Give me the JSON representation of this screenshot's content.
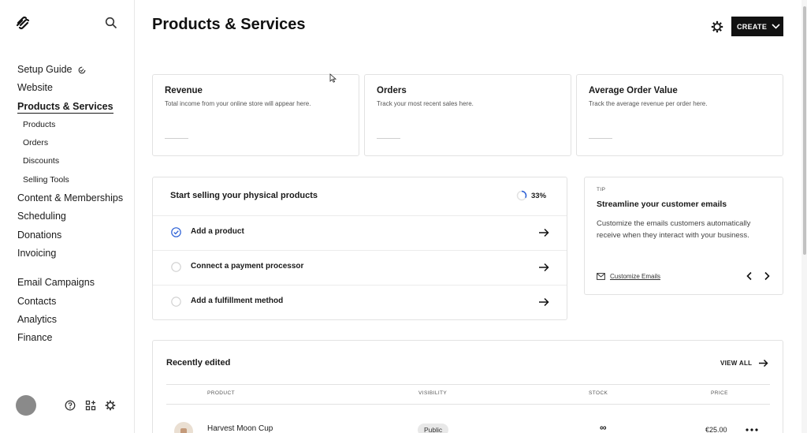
{
  "sidebar": {
    "nav": {
      "setup_guide": "Setup Guide",
      "website": "Website",
      "products_services": "Products & Services",
      "products": "Products",
      "orders": "Orders",
      "discounts": "Discounts",
      "selling_tools": "Selling Tools",
      "content_memberships": "Content & Memberships",
      "scheduling": "Scheduling",
      "donations": "Donations",
      "invoicing": "Invoicing",
      "email_campaigns": "Email Campaigns",
      "contacts": "Contacts",
      "analytics": "Analytics",
      "finance": "Finance"
    }
  },
  "header": {
    "title": "Products & Services",
    "create_label": "CREATE"
  },
  "stats": [
    {
      "title": "Revenue",
      "desc": "Total income from your online store will appear here."
    },
    {
      "title": "Orders",
      "desc": "Track your most recent sales here."
    },
    {
      "title": "Average Order Value",
      "desc": "Track the average revenue per order here."
    }
  ],
  "checklist": {
    "title": "Start selling your physical products",
    "progress": "33%",
    "progress_value": 0.33,
    "items": [
      {
        "label": "Add a product",
        "done": true
      },
      {
        "label": "Connect a payment processor",
        "done": false
      },
      {
        "label": "Add a fulfillment method",
        "done": false
      }
    ]
  },
  "tip": {
    "label": "TIP",
    "title": "Streamline your customer emails",
    "body": "Customize the emails customers automatically receive when they interact with your business.",
    "link": "Customize Emails"
  },
  "recent": {
    "title": "Recently edited",
    "view_all": "VIEW ALL",
    "columns": {
      "product": "PRODUCT",
      "visibility": "VISIBILITY",
      "stock": "STOCK",
      "price": "PRICE"
    },
    "rows": [
      {
        "name": "Harvest Moon Cup",
        "visibility": "Public",
        "stock": "∞",
        "price": "€25.00"
      }
    ]
  }
}
